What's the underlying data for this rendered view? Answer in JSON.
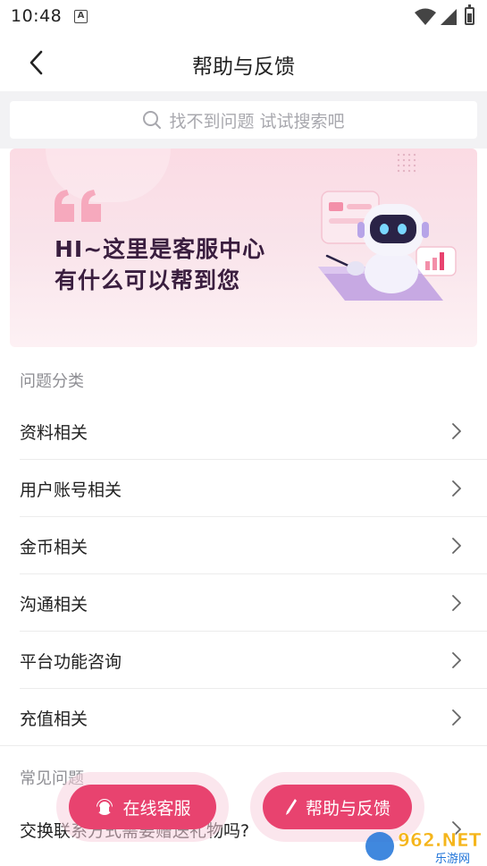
{
  "status_bar": {
    "time": "10:48",
    "notif_icon": "A"
  },
  "nav": {
    "title": "帮助与反馈",
    "back_icon": "chevron-left-icon"
  },
  "search": {
    "placeholder": "找不到问题 试试搜索吧"
  },
  "banner": {
    "line1": "HI~这里是客服中心",
    "line2": "有什么可以帮到您"
  },
  "categories": {
    "header": "问题分类",
    "items": [
      {
        "label": "资料相关"
      },
      {
        "label": "用户账号相关"
      },
      {
        "label": "金币相关"
      },
      {
        "label": "沟通相关"
      },
      {
        "label": "平台功能咨询"
      },
      {
        "label": "充值相关"
      }
    ]
  },
  "faq": {
    "header": "常见问题",
    "items": [
      {
        "label": "交换联系方式需要赠送礼物吗?"
      }
    ]
  },
  "buttons": {
    "online_service": "在线客服",
    "help_feedback": "帮助与反馈"
  },
  "watermark": {
    "brand": "962.NET",
    "sub": "乐游网"
  },
  "colors": {
    "accent": "#e8436f",
    "banner_bg": "#fbdbe4",
    "search_bg": "#f2f2f4"
  }
}
